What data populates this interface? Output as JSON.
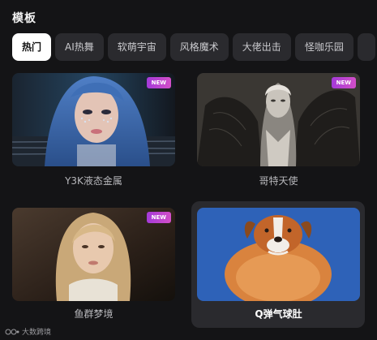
{
  "section": {
    "title": "模板"
  },
  "tabs": [
    {
      "label": "热门",
      "active": true
    },
    {
      "label": "AI热舞"
    },
    {
      "label": "软萌宇宙"
    },
    {
      "label": "风格魔术"
    },
    {
      "label": "大佬出击"
    },
    {
      "label": "怪咖乐园"
    }
  ],
  "templates": [
    {
      "title": "Y3K液态金属",
      "badge": "NEW"
    },
    {
      "title": "哥特天使",
      "badge": "NEW"
    },
    {
      "title": "鱼群梦境",
      "badge": "NEW"
    },
    {
      "title": "Q弹气球肚",
      "selected": true
    }
  ],
  "watermark": {
    "text": "大数跨境"
  }
}
